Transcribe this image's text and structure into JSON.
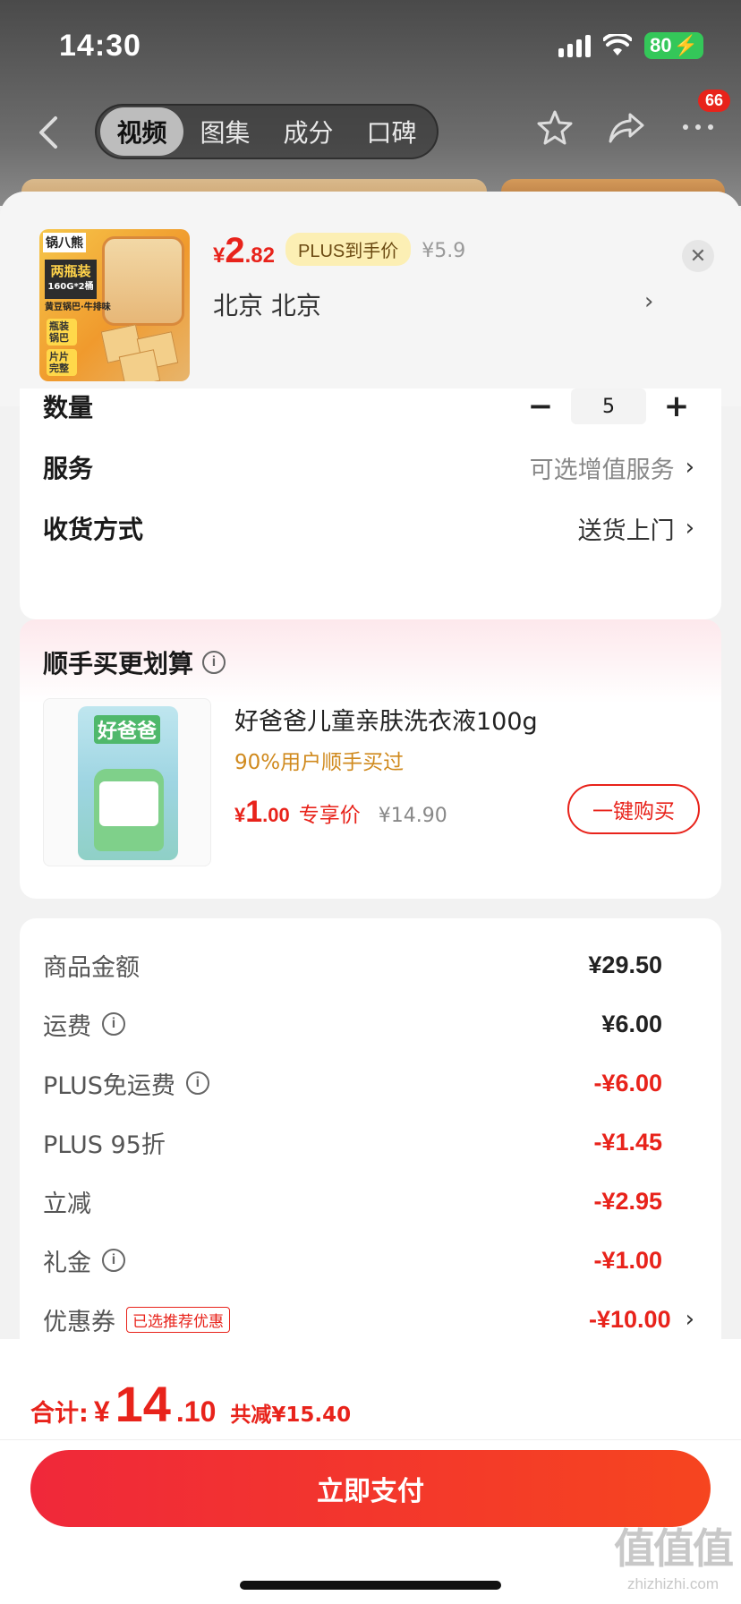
{
  "status_bar": {
    "time": "14:30",
    "battery": "80"
  },
  "nav": {
    "tabs": [
      {
        "label": "视频",
        "active": true
      },
      {
        "label": "图集",
        "active": false
      },
      {
        "label": "成分",
        "active": false
      },
      {
        "label": "口碑",
        "active": false
      }
    ],
    "more_badge": "66"
  },
  "product": {
    "thumb": {
      "brand": "锅八熊",
      "label_line1": "两瓶装",
      "label_line2": "160G*2桶",
      "sub": "黄豆锅巴·牛排味",
      "tag1": "瓶装锅巴",
      "tag2": "片片完整"
    },
    "price": {
      "yen": "¥",
      "int": "2",
      "dec": ".82"
    },
    "plus_tag": "PLUS到手价",
    "original_price": "¥5.9",
    "location": "北京  北京",
    "location_arrow": "›",
    "close": "✕"
  },
  "options": {
    "quantity": {
      "label": "数量",
      "minus": "−",
      "value": "5",
      "plus": "+"
    },
    "service": {
      "label": "服务",
      "value": "可选增值服务",
      "arrow": "›"
    },
    "delivery": {
      "label": "收货方式",
      "value": "送货上门",
      "arrow": "›"
    }
  },
  "bundle": {
    "title": "顺手买更划算",
    "info": "i",
    "item": {
      "thumb_brand": "好爸爸",
      "name": "好爸爸儿童亲肤洗衣液100g",
      "subtitle": "90%用户顺手买过",
      "price": {
        "yen": "¥",
        "int": "1",
        "dec": ".00"
      },
      "price_tag": "专享价",
      "original_price": "¥14.90",
      "buy_button": "一键购买"
    }
  },
  "summary": [
    {
      "label": "商品金额",
      "value": "¥29.50",
      "red": false,
      "info": false
    },
    {
      "label": "运费",
      "value": "¥6.00",
      "red": false,
      "info": true
    },
    {
      "label": "PLUS免运费",
      "value": "-¥6.00",
      "red": true,
      "info": true
    },
    {
      "label": "PLUS 95折",
      "value": "-¥1.45",
      "red": true,
      "info": false
    },
    {
      "label": "立减",
      "value": "-¥2.95",
      "red": true,
      "info": false
    },
    {
      "label": "礼金",
      "value": "-¥1.00",
      "red": true,
      "info": true
    },
    {
      "label": "优惠券",
      "value": "-¥10.00",
      "red": true,
      "info": false,
      "tag": "已选推荐优惠",
      "arrow": "›"
    }
  ],
  "footer": {
    "total_label": "合计:",
    "total_yen": "¥",
    "total_int": "14",
    "total_dec": ".10",
    "total_save": "共减¥15.40",
    "pay_button": "立即支付"
  },
  "watermark": {
    "logo": "值值值",
    "url": "zhizhizhi.com"
  },
  "colors": {
    "accent_red": "#e8231b",
    "plus_gold": "#fcefb4",
    "subtitle_orange": "#d08a1e"
  }
}
